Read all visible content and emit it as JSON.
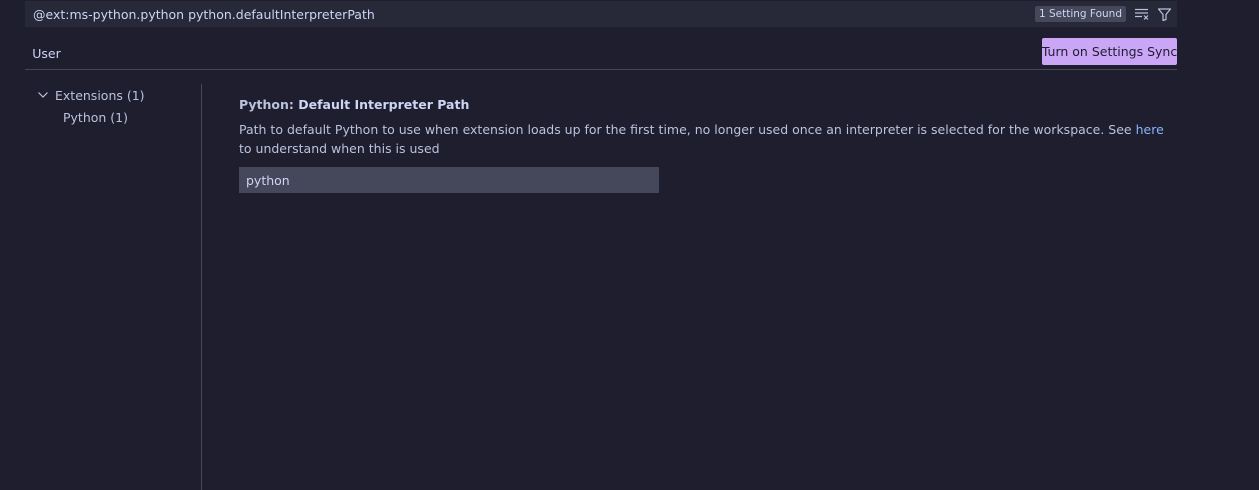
{
  "search": {
    "query": "@ext:ms-python.python python.defaultInterpreterPath",
    "result_badge": "1 Setting Found",
    "clear_icon": "clear-filter-icon",
    "filter_icon": "filter-icon"
  },
  "tabs": {
    "user_label": "User",
    "sync_button_label": "Turn on Settings Sync"
  },
  "toc": {
    "items": [
      {
        "label": "Extensions (1)",
        "expanded": true
      },
      {
        "label": "Python (1)"
      }
    ]
  },
  "setting": {
    "category": "Python: ",
    "name": "Default Interpreter Path",
    "description_before": "Path to default Python to use when extension loads up for the first time, no longer used once an interpreter is selected for the workspace. See ",
    "description_link": "here",
    "description_after": " to understand when this is used",
    "value": "python"
  },
  "colors": {
    "background": "#1e1e2e",
    "accent": "#cba6f7",
    "link": "#89b4fa"
  }
}
